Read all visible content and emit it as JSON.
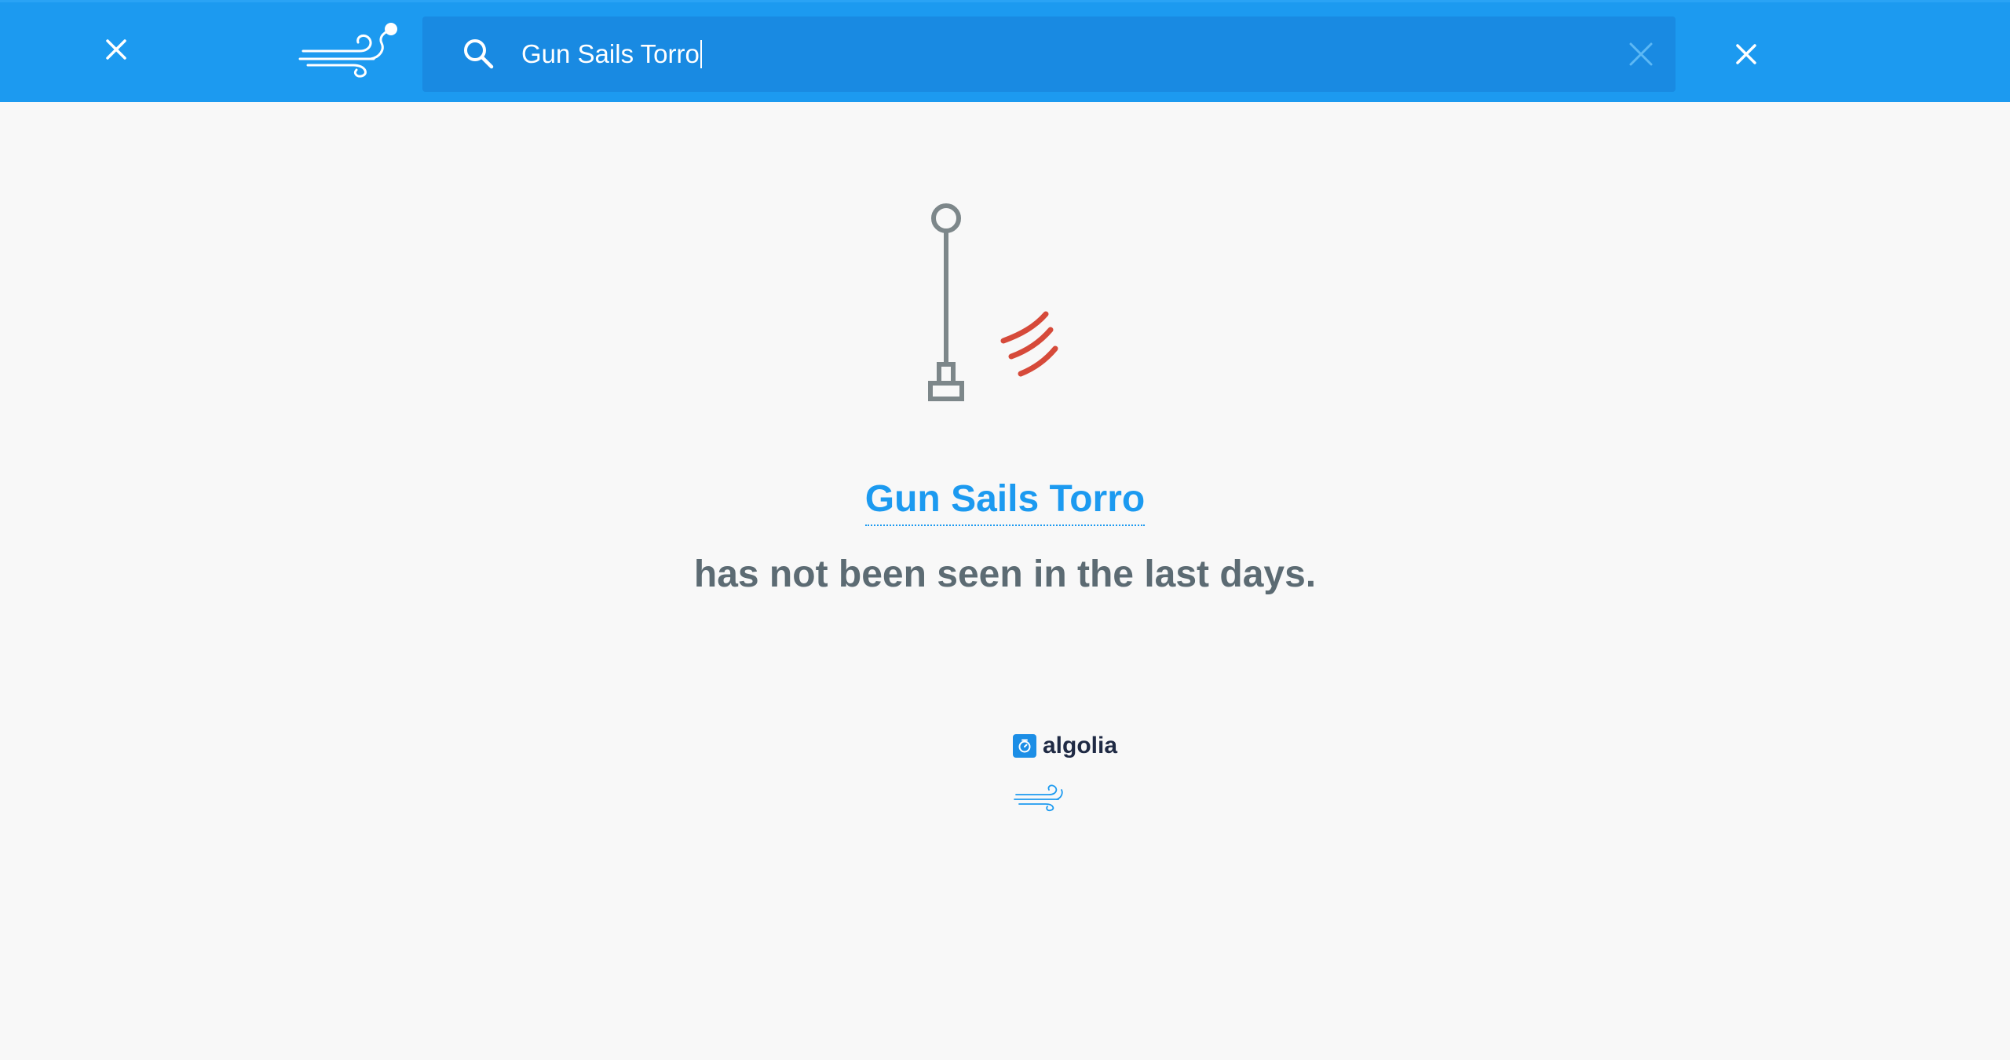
{
  "header": {
    "close_left_icon": "close-icon",
    "logo_icon": "wind-logo-icon",
    "search": {
      "icon": "search-icon",
      "value": "Gun Sails Torro",
      "clear_icon": "clear-icon"
    },
    "close_right_icon": "close-icon"
  },
  "empty_state": {
    "illustration_icon": "windsock-pole-icon",
    "query": "Gun Sails Torro",
    "message": "has not been seen in the last days."
  },
  "footer": {
    "powered_by_icon": "algolia-icon",
    "powered_by_label": "algolia",
    "brand_icon": "wind-logo-icon"
  },
  "colors": {
    "header_bg": "#1c9af0",
    "search_bg": "#198ae2",
    "accent": "#1c9af0",
    "message_text": "#5c6b73",
    "wind_red": "#d64a3a",
    "pole_gray": "#7d878a",
    "page_bg": "#f8f8f8"
  }
}
